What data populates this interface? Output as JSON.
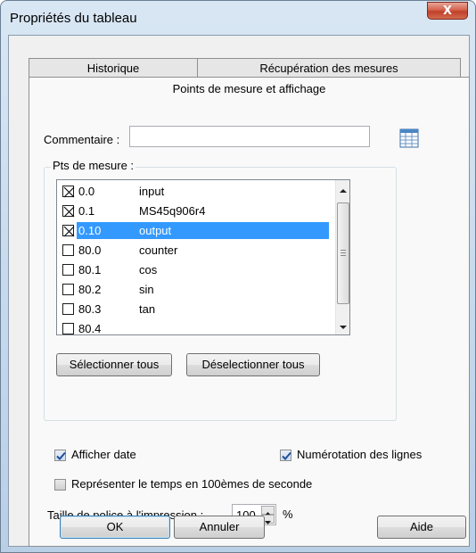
{
  "window": {
    "title": "Propriétés du tableau",
    "close_label": "X"
  },
  "tabs": {
    "historique": "Historique",
    "recuperation": "Récupération des mesures",
    "active": "Points de mesure et affichage"
  },
  "comment": {
    "label": "Commentaire :",
    "value": ""
  },
  "points": {
    "group_title": "Pts de mesure :",
    "items": [
      {
        "id": "0.0",
        "name": "input",
        "checked": true,
        "selected": false
      },
      {
        "id": "0.1",
        "name": "MS45q906r4",
        "checked": true,
        "selected": false
      },
      {
        "id": "0.10",
        "name": "output",
        "checked": true,
        "selected": true
      },
      {
        "id": "80.0",
        "name": "counter",
        "checked": false,
        "selected": false
      },
      {
        "id": "80.1",
        "name": "cos",
        "checked": false,
        "selected": false
      },
      {
        "id": "80.2",
        "name": "sin",
        "checked": false,
        "selected": false
      },
      {
        "id": "80.3",
        "name": "tan",
        "checked": false,
        "selected": false
      },
      {
        "id": "80.4",
        "name": "",
        "checked": false,
        "selected": false
      }
    ],
    "select_all": "Sélectionner tous",
    "deselect_all": "Déselectionner tous"
  },
  "options": {
    "show_date": "Afficher date",
    "show_date_checked": true,
    "line_numbering": "Numérotation des lignes",
    "line_numbering_checked": true,
    "hundredths": "Représenter le temps en 100èmes de seconde",
    "hundredths_checked": false,
    "font_size_label": "Taille de police à l'impression :",
    "font_size_value": "100",
    "font_size_unit": "%"
  },
  "buttons": {
    "ok": "OK",
    "cancel": "Annuler",
    "help": "Aide"
  },
  "icons": {
    "table_icon": "table-icon",
    "scroll_up": "scroll-up-arrow-icon",
    "scroll_down": "scroll-down-arrow-icon"
  }
}
